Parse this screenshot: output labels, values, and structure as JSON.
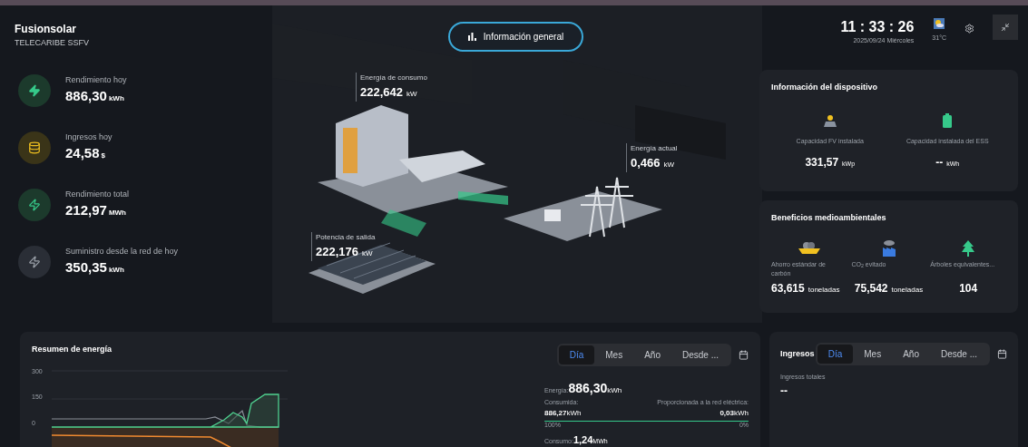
{
  "app": {
    "logo": "Fusionsolar",
    "plant": "TELECARIBE SSFV"
  },
  "overview_button": {
    "label": "Información general",
    "selected": true
  },
  "clock": {
    "time": "11 : 33 : 26",
    "date": "2025/09/24 Miércoles"
  },
  "weather": {
    "temperature": "31°C"
  },
  "metrics": [
    {
      "kind": "yield",
      "label": "Rendimiento hoy",
      "value": "886,30",
      "unit": "kWh"
    },
    {
      "kind": "revenue",
      "label": "Ingresos hoy",
      "value": "24,58",
      "unit": "$"
    },
    {
      "kind": "total",
      "label": "Rendimiento total",
      "value": "212,97",
      "unit": "MWh"
    },
    {
      "kind": "grid",
      "label": "Suministro desde la red de hoy",
      "value": "350,35",
      "unit": "kWh"
    }
  ],
  "flow": [
    {
      "kind": "consumption",
      "label": "Energía de consumo",
      "value": "222,642",
      "unit": "kW"
    },
    {
      "kind": "grid",
      "label": "Energía actual",
      "value": "0,466",
      "unit": "kW"
    },
    {
      "kind": "pv",
      "label": "Potencia de salida",
      "value": "222,176",
      "unit": "kW"
    }
  ],
  "device_info": {
    "title": "Información del dispositivo",
    "items": [
      {
        "kind": "pv",
        "label": "Capacidad FV instalada",
        "value": "331,57",
        "unit": "kWp"
      },
      {
        "kind": "ess",
        "label": "Capacidad instalada del ESS",
        "value": "--",
        "unit": "kWh"
      }
    ]
  },
  "environment": {
    "title": "Beneficios medioambientales",
    "items": [
      {
        "kind": "coal",
        "label": "Ahorro estándar de carbón",
        "value": "63,615",
        "unit": "toneladas"
      },
      {
        "kind": "co2",
        "label": "CO$_{2}$ evitado",
        "value": "75,542",
        "unit": "toneladas"
      },
      {
        "kind": "trees",
        "label": "Árboles equivalentes...",
        "value": "104"
      }
    ]
  },
  "energy_summary": {
    "title": "Resumen de energía",
    "periods": [
      {
        "label": "Día",
        "selected": true
      },
      {
        "label": "Mes",
        "selected": false
      },
      {
        "label": "Año",
        "selected": false
      },
      {
        "label": "Desde ...",
        "selected": false
      }
    ],
    "y_axis_labels": [
      "300",
      "150",
      "0"
    ],
    "energy_label": "Energía:",
    "energy_value": "886,30",
    "energy_unit": "kWh",
    "consumed_label": "Consumida:",
    "consumed_value": "886,27",
    "consumed_unit": "kWh",
    "fed_label": "Proporcionada a la red eléctrica:",
    "fed_value": "0,03",
    "fed_unit": "kWh",
    "level": 1,
    "left_percent": "100%",
    "right_percent": "0%",
    "consumption_label": "Consumo:",
    "consumption_value": "1,24",
    "consumption_unit": "MWh"
  },
  "revenue": {
    "title": "Ingresos",
    "periods": [
      {
        "label": "Día",
        "selected": true
      },
      {
        "label": "Mes",
        "selected": false
      },
      {
        "label": "Año",
        "selected": false
      },
      {
        "label": "Desde ...",
        "selected": false
      }
    ],
    "total_label": "Ingresos totales",
    "total_value": "--"
  }
}
